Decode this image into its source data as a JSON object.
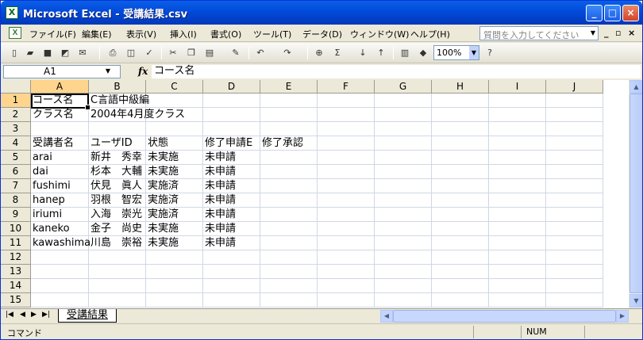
{
  "window": {
    "title": "Microsoft Excel - 受講結果.csv",
    "app_letter": "X"
  },
  "title_buttons": {
    "minimize": "_",
    "maximize": "□",
    "close": "×"
  },
  "menu": {
    "items": [
      "ファイル(F)",
      "編集(E)",
      "表示(V)",
      "挿入(I)",
      "書式(O)",
      "ツール(T)",
      "データ(D)",
      "ウィンドウ(W)",
      "ヘルプ(H)"
    ],
    "help_placeholder": "質問を入力してください",
    "mdi": {
      "minimize": "_",
      "restore": "▫",
      "close": "×"
    }
  },
  "toolbar": {
    "tools": [
      {
        "name": "new-icon",
        "glyph": "▯"
      },
      {
        "name": "open-icon",
        "glyph": "▰"
      },
      {
        "name": "save-icon",
        "glyph": "■"
      },
      {
        "name": "permission-icon",
        "glyph": "◩"
      },
      {
        "name": "email-icon",
        "glyph": "✉"
      },
      {
        "name": "print-icon",
        "glyph": "⎙"
      },
      {
        "name": "print-preview-icon",
        "glyph": "◫"
      },
      {
        "name": "spelling-icon",
        "glyph": "✓"
      },
      {
        "name": "cut-icon",
        "glyph": "✂"
      },
      {
        "name": "copy-icon",
        "glyph": "❐"
      },
      {
        "name": "paste-icon",
        "glyph": "▤"
      },
      {
        "name": "format-painter-icon",
        "glyph": "✎"
      },
      {
        "name": "undo-icon",
        "glyph": "↶"
      },
      {
        "name": "redo-icon",
        "glyph": "↷"
      },
      {
        "name": "hyperlink-icon",
        "glyph": "⊕"
      },
      {
        "name": "autosum-icon",
        "glyph": "Σ"
      },
      {
        "name": "sort-ascending-icon",
        "glyph": "↓"
      },
      {
        "name": "sort-descending-icon",
        "glyph": "↑"
      },
      {
        "name": "chart-wizard-icon",
        "glyph": "▥"
      },
      {
        "name": "drawing-icon",
        "glyph": "◆"
      },
      {
        "name": "help-icon",
        "glyph": "?"
      }
    ],
    "zoom": "100%"
  },
  "formula_bar": {
    "name_box": "A1",
    "fx": "fx",
    "formula": "コース名"
  },
  "sheet": {
    "columns": [
      "A",
      "B",
      "C",
      "D",
      "E",
      "F",
      "G",
      "H",
      "I",
      "J"
    ],
    "rows": [
      "1",
      "2",
      "3",
      "4",
      "5",
      "6",
      "7",
      "8",
      "9",
      "10",
      "11",
      "12",
      "13",
      "14",
      "15"
    ],
    "cells": [
      [
        "コース名",
        "C言語中級編",
        "",
        "",
        ""
      ],
      [
        "クラス名",
        "2004年4月度クラス",
        "",
        "",
        ""
      ],
      [
        "",
        "",
        "",
        "",
        ""
      ],
      [
        "受講者名",
        "ユーザID",
        "状態",
        "修了申請E",
        "修了承認"
      ],
      [
        "arai",
        "新井　秀幸",
        "未実施",
        "未申請",
        ""
      ],
      [
        "dai",
        "杉本　大輔",
        "未実施",
        "未申請",
        ""
      ],
      [
        "fushimi",
        "伏見　眞人",
        "実施済",
        "未申請",
        ""
      ],
      [
        "hanep",
        "羽根　智宏",
        "実施済",
        "未申請",
        ""
      ],
      [
        "iriumi",
        "入海　崇光",
        "実施済",
        "未申請",
        ""
      ],
      [
        "kaneko",
        "金子　尚史",
        "未実施",
        "未申請",
        ""
      ],
      [
        "kawashima",
        "川島　崇裕",
        "未実施",
        "未申請",
        ""
      ]
    ]
  },
  "sheet_tabs": {
    "active": "受講結果"
  },
  "status": {
    "text": "コマンド",
    "num": "NUM"
  }
}
